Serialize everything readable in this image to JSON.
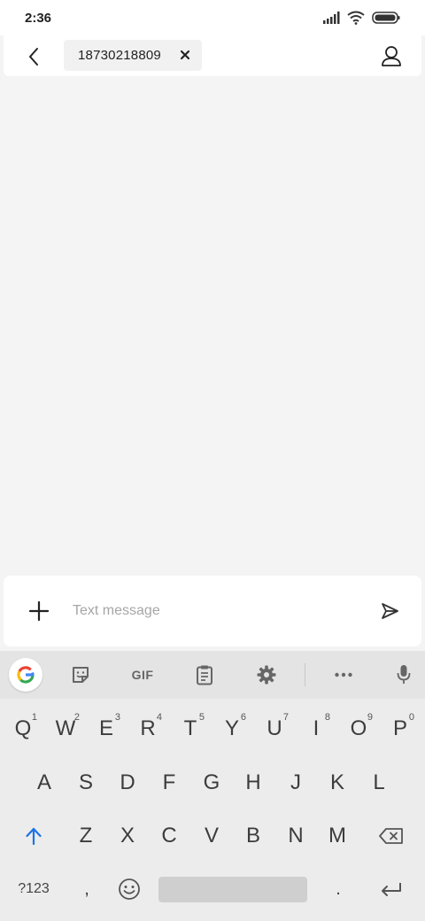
{
  "status_bar": {
    "time": "2:36"
  },
  "header": {
    "back_icon": "chevron-left-icon",
    "recipient": "18730218809",
    "remove_icon": "close-icon",
    "contact_icon": "person-icon"
  },
  "compose": {
    "attach_icon": "plus-icon",
    "placeholder": "Text message",
    "send_icon": "send-icon"
  },
  "keyboard": {
    "toolbar": {
      "gif_label": "GIF"
    },
    "row1": [
      {
        "label": "Q",
        "hint": "1"
      },
      {
        "label": "W",
        "hint": "2"
      },
      {
        "label": "E",
        "hint": "3"
      },
      {
        "label": "R",
        "hint": "4"
      },
      {
        "label": "T",
        "hint": "5"
      },
      {
        "label": "Y",
        "hint": "6"
      },
      {
        "label": "U",
        "hint": "7"
      },
      {
        "label": "I",
        "hint": "8"
      },
      {
        "label": "O",
        "hint": "9"
      },
      {
        "label": "P",
        "hint": "0"
      }
    ],
    "row2": [
      "A",
      "S",
      "D",
      "F",
      "G",
      "H",
      "J",
      "K",
      "L"
    ],
    "row3": [
      "Z",
      "X",
      "C",
      "V",
      "B",
      "N",
      "M"
    ],
    "row4": {
      "symbols_label": "?123",
      "comma_label": ",",
      "period_label": "."
    },
    "colors": {
      "shift_accent": "#1a73e8"
    }
  }
}
